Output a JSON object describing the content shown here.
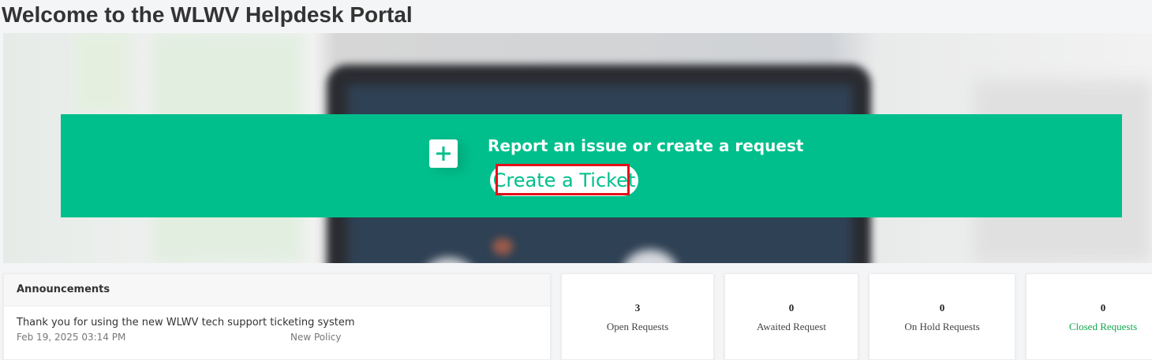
{
  "page": {
    "title": "Welcome to the WLWV Helpdesk Portal"
  },
  "banner": {
    "heading": "Report an issue or create a request",
    "button_label": "Create a Ticket",
    "icon": "plus-icon",
    "color": "#00bf8c"
  },
  "announcements": {
    "title": "Announcements",
    "items": [
      {
        "title": "Thank you for using the new WLWV tech support ticketing system",
        "date": "Feb 19, 2025 03:14 PM",
        "category": "New Policy"
      }
    ]
  },
  "stats": [
    {
      "count": "3",
      "label": "Open Requests"
    },
    {
      "count": "0",
      "label": "Awaited Request"
    },
    {
      "count": "0",
      "label": "On Hold Requests"
    },
    {
      "count": "0",
      "label": "Closed Requests",
      "color": "#13a84e"
    }
  ],
  "colors": {
    "highlight": "#e3101a"
  }
}
